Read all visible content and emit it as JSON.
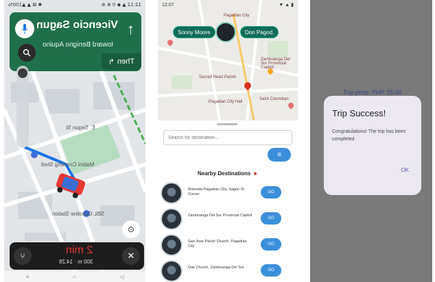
{
  "panel1": {
    "status_left": "12:12 ▲ ◆ 0 ⊕ ⊕",
    "status_right": "✱ ⊠ ▲ ▲100%",
    "street": "Vicencio Sagun",
    "onto_text": "toward Benigno Aquino",
    "then_label": "Then",
    "map_labels": {
      "road1": "E. Sagun St",
      "place1": "Mabini Crossing Shell",
      "place2": "SBL Gasoline Station"
    },
    "eta": "2 min",
    "distance_time": "300 m · 14:28",
    "nav_items": [
      "≡",
      "○",
      "◁"
    ]
  },
  "panel2": {
    "status_left": "12:07",
    "status_right": "▼ ▲ ▮",
    "pill_left": "Sonny Moore",
    "pill_right": "Don Pagod.",
    "map_labels": {
      "top": "Pagadian City",
      "poi1": "Zamboanga Del Sur Provincial Capitol",
      "poi2": "Sacred Heart Parish",
      "poi3": "Pagadian City Hall",
      "poi4": "Saint Columban"
    },
    "search_placeholder": "Search for destination...",
    "filter_icon": "≡",
    "nearby_title": "Nearby Destinations",
    "destinations": [
      {
        "name": "Rotonda Pagadian City, Sagun St Corner",
        "go": "GO"
      },
      {
        "name": "Zamboanga Del Sur Provincial Capitol",
        "go": "GO"
      },
      {
        "name": "San Jose Parish Church, Pagadian City",
        "go": "GO"
      },
      {
        "name": "Dao Church, Zamboanga Del Sur",
        "go": "GO"
      }
    ]
  },
  "panel3": {
    "bg_title": "Trip price: PHP 25.00",
    "dialog_title": "Trip Success!",
    "dialog_message": "Congratulations! The trip has been completed",
    "ok_label": "OK"
  }
}
